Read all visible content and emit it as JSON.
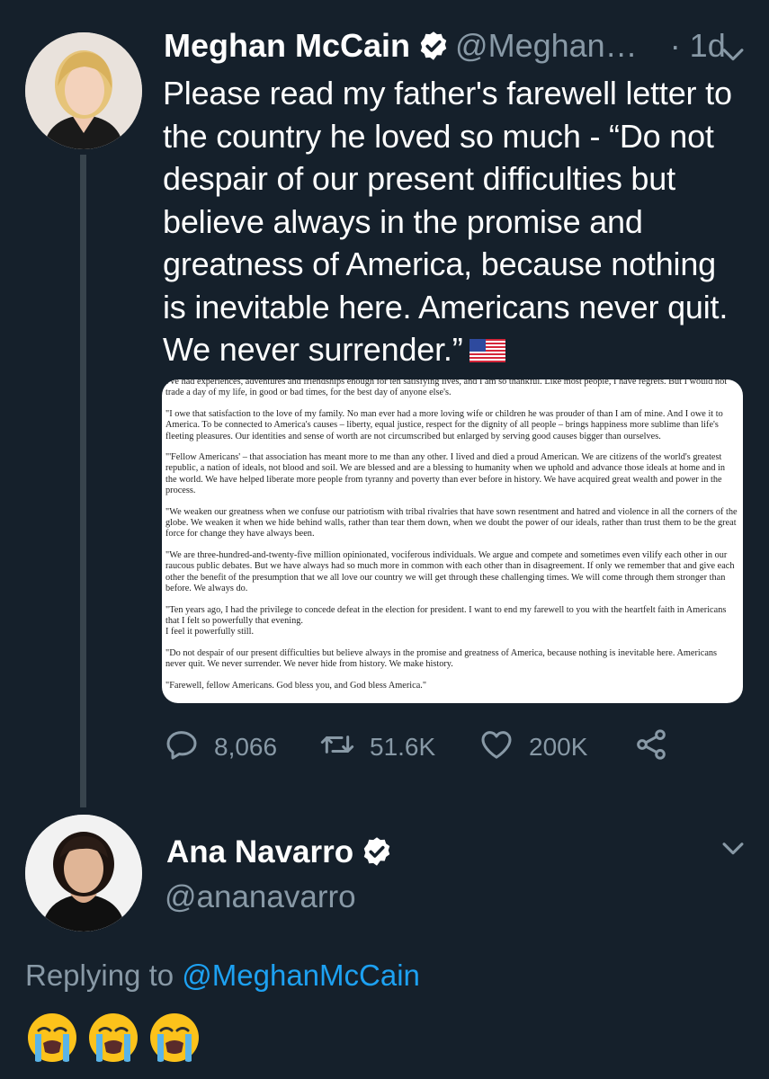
{
  "tweet": {
    "author_name": "Meghan McCain",
    "author_handle": "@Meghan…",
    "time": "· 1d",
    "text": "Please read my father's farewell letter to the country he loved so much - “Do not despair of our present difficulties but believe always in the promise and greatness of America, because nothing is inevitable here. Americans never quit. We never surrender.”",
    "flag_icon": "us-flag-icon",
    "letter_paragraphs": [
      "I've had experiences, adventures and friendships enough for ten satisfying lives, and I am so thankful. Like most people, I have regrets. But I would not trade a day of my life, in good or bad times, for the best day of anyone else's.",
      "\"I owe that satisfaction to the love of my family. No man ever had a more loving wife or children he was prouder of than I am of mine. And I owe it to America. To be connected to America's causes – liberty, equal justice, respect for the dignity of all people – brings happiness more sublime than life's fleeting pleasures. Our identities and sense of worth are not circumscribed but enlarged by serving good causes bigger than ourselves.",
      "\"'Fellow Americans' – that association has meant more to me than any other. I lived and died a proud American. We are citizens of the world's greatest republic, a nation of ideals, not blood and soil. We are blessed and are a blessing to humanity when we uphold and advance those ideals at home and in the world. We have helped liberate more people from tyranny and poverty than ever before in history. We have acquired great wealth and power in the process.",
      "\"We weaken our greatness when we confuse our patriotism with tribal rivalries that have sown resentment and hatred and violence in all the corners of the globe. We weaken it when we hide behind walls, rather than tear them down, when we doubt the power of our ideals, rather than trust them to be the great force for change they have always been.",
      "\"We are three-hundred-and-twenty-five million opinionated, vociferous individuals. We argue and compete and sometimes even vilify each other in our raucous public debates. But we have always had so much more in common with each other than in disagreement. If only we remember that and give each other the benefit of the presumption that we all love our country we will get through these challenging times. We will come through them stronger than before. We always do.",
      "\"Ten years ago, I had the privilege to concede defeat in the election for president. I want to end my farewell to you with the heartfelt faith in Americans that I felt so powerfully that evening.\nI feel it powerfully still.",
      "\"Do not despair of our present difficulties but believe always in the promise and greatness of America, because nothing is inevitable here. Americans never quit. We never surrender. We never hide from history. We make history.",
      "\"Farewell, fellow Americans. God bless you, and God bless America.\""
    ],
    "stats": {
      "replies": "8,066",
      "retweets": "51.6K",
      "likes": "200K"
    }
  },
  "reply": {
    "author_name": "Ana Navarro",
    "author_handle": "@ananavarro",
    "replying_label": "Replying to",
    "replying_to": "@MeghanMcCain",
    "emojis": [
      "loudly-crying-face-icon",
      "loudly-crying-face-icon",
      "loudly-crying-face-icon"
    ]
  },
  "colors": {
    "background": "#15202b",
    "muted_text": "#8899a6",
    "link": "#1da1f2",
    "thread_line": "#38444d"
  }
}
